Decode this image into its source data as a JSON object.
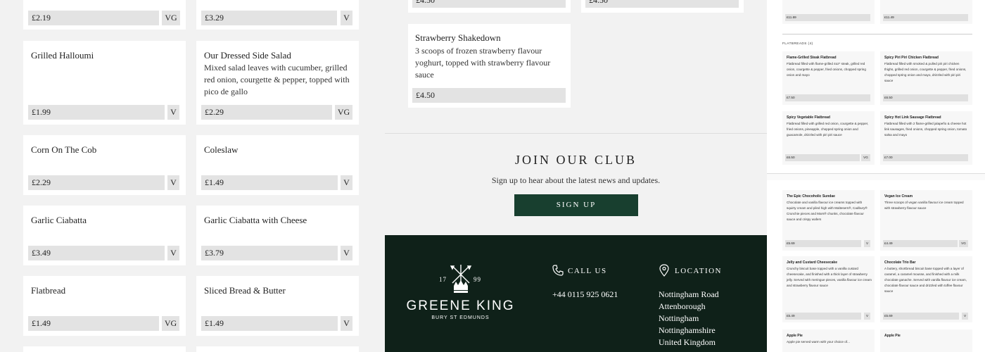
{
  "left_menu": {
    "row0": [
      {
        "price": "£2.19",
        "diet": "VG"
      },
      {
        "price": "£3.29",
        "diet": "V"
      }
    ],
    "items": [
      {
        "name": "Grilled Halloumi",
        "desc": "",
        "price": "£1.99",
        "diet": "V"
      },
      {
        "name": "Our Dressed Side Salad",
        "desc": "Mixed salad leaves with cucumber, grilled red onion, courgette & pepper, topped with pico de gallo",
        "price": "£2.29",
        "diet": "VG"
      },
      {
        "name": "Corn On The Cob",
        "desc": "",
        "price": "£2.29",
        "diet": "V"
      },
      {
        "name": "Coleslaw",
        "desc": "",
        "price": "£1.49",
        "diet": "V"
      },
      {
        "name": "Garlic Ciabatta",
        "desc": "",
        "price": "£3.49",
        "diet": "V"
      },
      {
        "name": "Garlic Ciabatta with Cheese",
        "desc": "",
        "price": "£3.79",
        "diet": "V"
      },
      {
        "name": "Flatbread",
        "desc": "",
        "price": "£1.49",
        "diet": "VG"
      },
      {
        "name": "Sliced Bread & Butter",
        "desc": "",
        "price": "£1.49",
        "diet": "V"
      }
    ]
  },
  "mid_menu": {
    "top_prices": [
      "£4.50",
      "£4.50"
    ],
    "item": {
      "name": "Strawberry Shakedown",
      "desc": "3 scoops of frozen strawberry flavour yoghurt, topped with strawberry flavour sauce",
      "price": "£4.50"
    }
  },
  "club": {
    "title": "JOIN OUR CLUB",
    "subtitle": "Sign up to hear about the latest news and updates.",
    "button": "SIGN UP"
  },
  "footer": {
    "logo": {
      "year_left": "17",
      "year_right": "99",
      "brand": "GREENE KING",
      "sub": "BURY ST EDMUNDS"
    },
    "call_heading": "CALL US",
    "phone": "+44 0115 925 0621",
    "location_heading": "LOCATION",
    "address": [
      "Nottingham Road",
      "Attenborough",
      "Nottingham",
      "Nottinghamshire",
      "United Kingdom"
    ]
  },
  "right_menu": {
    "top": [
      {
        "desc": "...",
        "price": "£11.69"
      },
      {
        "desc": "...",
        "price": "£11.49"
      }
    ],
    "section": "FLATBREADS (4)",
    "flatbreads": [
      {
        "name": "Flame-Grilled Steak Flatbread",
        "desc": "Flatbread filled with flame-grilled 4oz* steak, grilled red onion, courgette & pepper, fried onions, chopped spring onion and mayo",
        "price": "£7.50",
        "diet": ""
      },
      {
        "name": "Spicy Piri Piri Chicken Flatbread",
        "desc": "Flatbread filled with smoked & pulled piri piri chicken thighs, grilled red onion, courgette & pepper, fried onions, chopped spring onion and mayo, drizzled with piri piri sauce",
        "price": "£6.50",
        "diet": ""
      },
      {
        "name": "Spicy Vegetable Flatbread",
        "desc": "Flatbread filled with grilled red onion, courgette & pepper, fried onions, pineapple, chopped spring onion and guacamole, drizzled with piri piri sauce",
        "price": "£6.50",
        "diet": "VG"
      },
      {
        "name": "Spicy Hot Link Sausage Flatbread",
        "desc": "Flatbread filled with 2 flame-grilled jalapeño & cheese hot link sausages, fried onions, chopped spring onion, tomato salsa and mayo",
        "price": "£7.00",
        "diet": ""
      }
    ],
    "desserts": [
      {
        "name": "The Epic Chocoholic Sundae",
        "desc": "Chocolate and vanilla flavour ice creams topped with squirty cream and piled high with Maltesers®, Cadbury® Crunchie pieces and Mars® chunks, chocolate flavour sauce and crispy wafers",
        "price": "£5.69",
        "diet": "V"
      },
      {
        "name": "Vegan Ice Cream",
        "desc": "Three scoops of vegan vanilla flavour ice cream topped with strawberry flavour sauce",
        "price": "£4.49",
        "diet": "VG"
      },
      {
        "name": "Jelly and Custard Cheesecake",
        "desc": "Crunchy biscuit base topped with a vanilla custard cheesecake, and finished with a thick layer of strawberry jelly. Served with meringue pieces, vanilla flavour ice cream and strawberry flavour sauce",
        "price": "£5.49",
        "diet": "V"
      },
      {
        "name": "Chocolate Trio Bar",
        "desc": "A buttery, shortbread biscuit base topped with a layer of caramel, a caramel mousse, and finished with a milk chocolate ganache. Served with vanilla flavour ice cream, chocolate flavour sauce and drizzled with toffee flavour sauce",
        "price": "£5.69",
        "diet": "V"
      }
    ],
    "pies": [
      {
        "name": "Apple Pie",
        "desc": "Apple pie served warm with your choice of..."
      },
      {
        "name": "Apple Pie",
        "desc": ""
      }
    ]
  }
}
